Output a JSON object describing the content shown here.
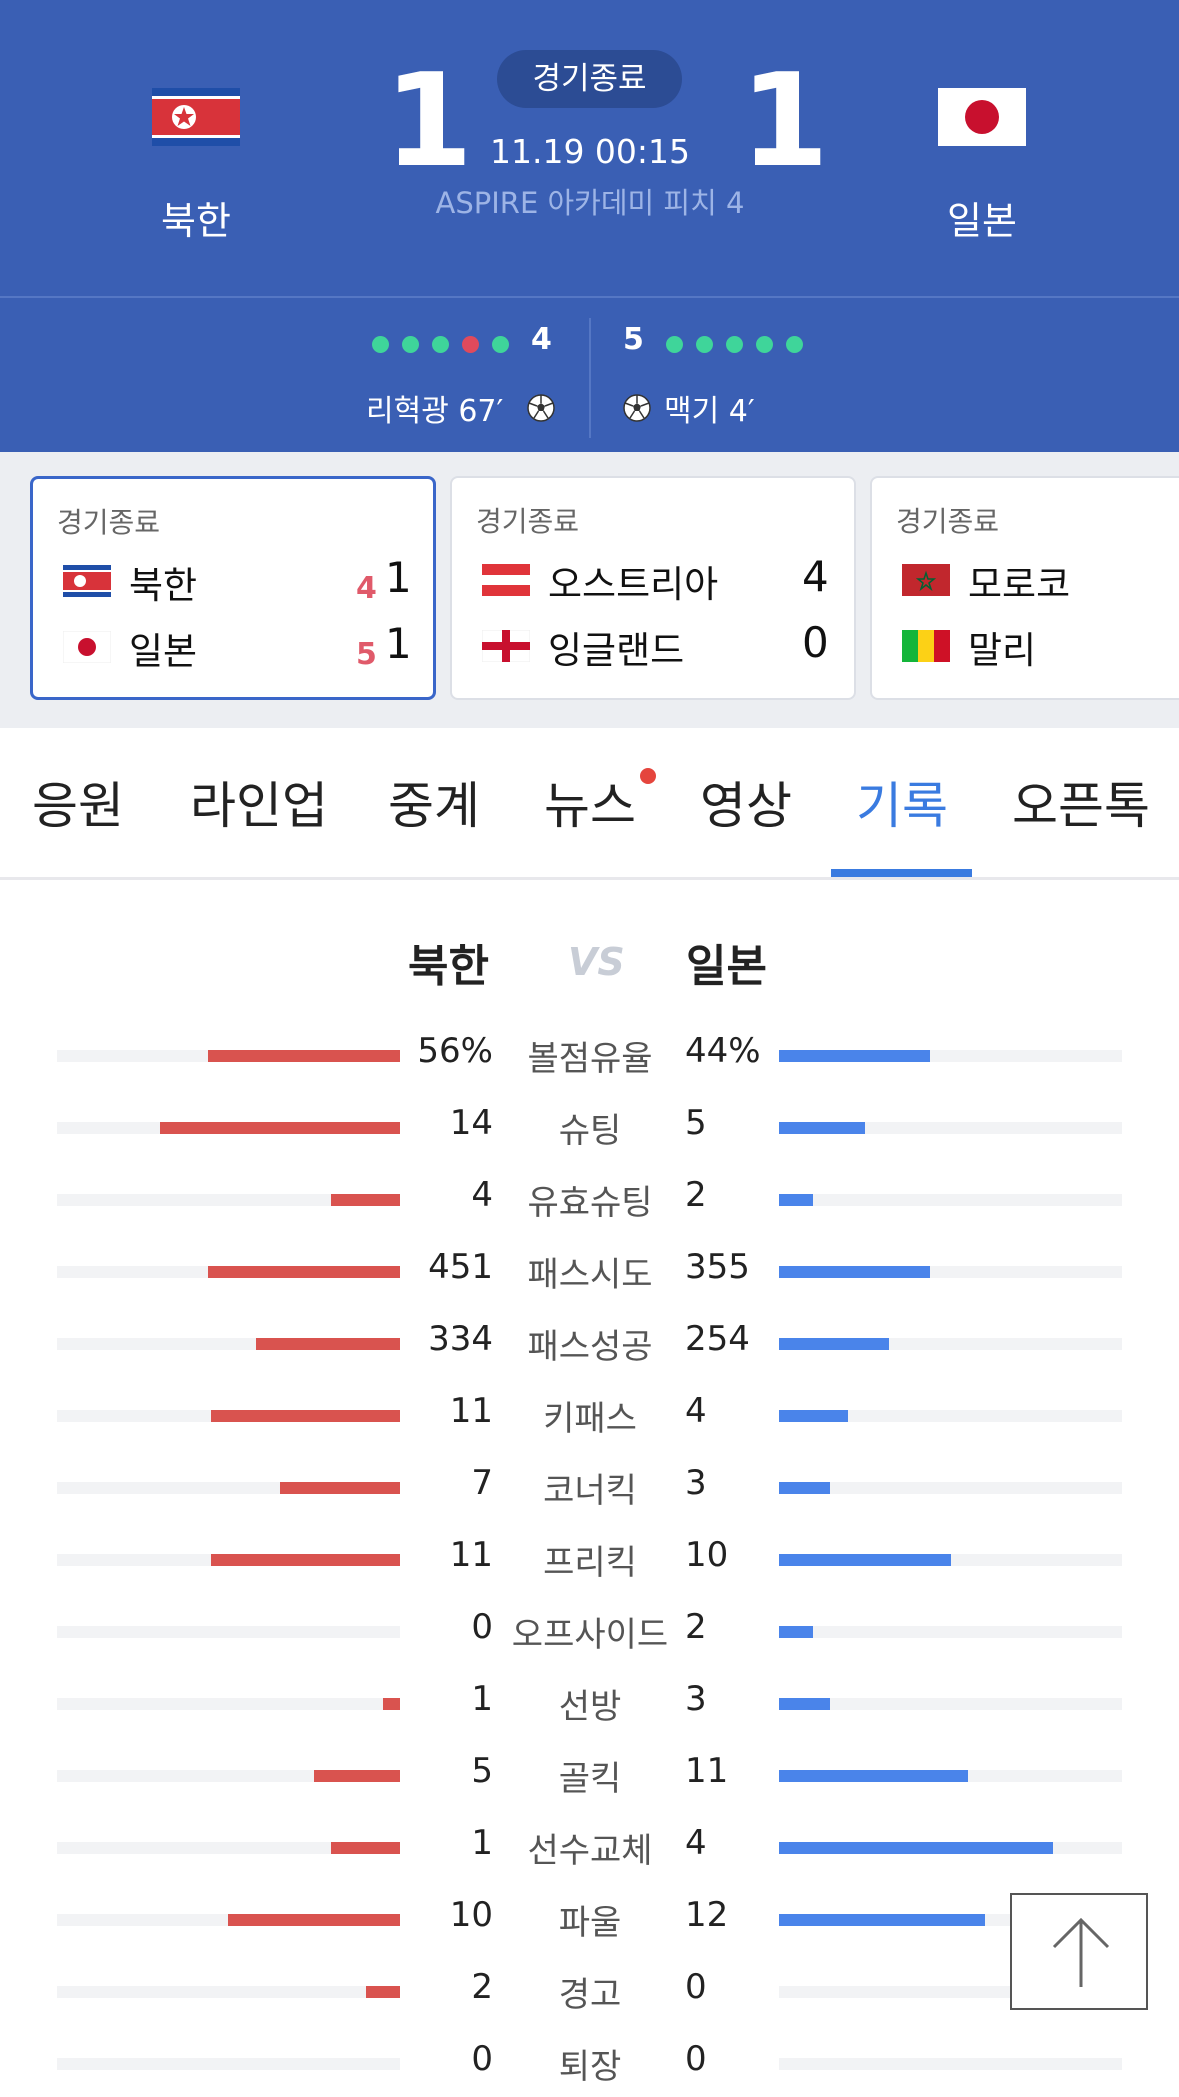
{
  "header": {
    "status": "경기종료",
    "home_team": "북한",
    "away_team": "일본",
    "home_score": "1",
    "away_score": "1",
    "datetime": "11.19 00:15",
    "venue": "ASPIRE 아카데미 피치 4"
  },
  "shootout": {
    "home_pk": "4",
    "away_pk": "5",
    "home_kicks": [
      "scored",
      "scored",
      "scored",
      "missed",
      "scored"
    ],
    "away_kicks": [
      "scored",
      "scored",
      "scored",
      "scored",
      "scored"
    ],
    "home_scorer": "리혁광 67′",
    "away_scorer": "맥기 4′",
    "colors": {
      "scored": "#3fd59a",
      "missed": "#e04a5c"
    }
  },
  "cards": [
    {
      "status": "경기종료",
      "home": "북한",
      "away": "일본",
      "home_pk": "4",
      "away_pk": "5",
      "home_score": "1",
      "away_score": "1"
    },
    {
      "status": "경기종료",
      "home": "오스트리아",
      "away": "잉글랜드",
      "home_score": "4",
      "away_score": "0"
    },
    {
      "status": "경기종료",
      "home": "모로코",
      "away": "말리"
    }
  ],
  "tabs": [
    "응원",
    "라인업",
    "중계",
    "뉴스",
    "영상",
    "기록",
    "오픈톡"
  ],
  "active_tab": "기록",
  "stats_header": {
    "home": "북한",
    "vs": "VS",
    "away": "일본"
  },
  "stats": [
    {
      "label": "볼점유율",
      "home": "56%",
      "away": "44%",
      "home_frac": 0.56,
      "away_frac": 0.44
    },
    {
      "label": "슈팅",
      "home": "14",
      "away": "5",
      "home_frac": 0.7,
      "away_frac": 0.25
    },
    {
      "label": "유효슈팅",
      "home": "4",
      "away": "2",
      "home_frac": 0.2,
      "away_frac": 0.1
    },
    {
      "label": "패스시도",
      "home": "451",
      "away": "355",
      "home_frac": 0.56,
      "away_frac": 0.44
    },
    {
      "label": "패스성공",
      "home": "334",
      "away": "254",
      "home_frac": 0.42,
      "away_frac": 0.32
    },
    {
      "label": "키패스",
      "home": "11",
      "away": "4",
      "home_frac": 0.55,
      "away_frac": 0.2
    },
    {
      "label": "코너킥",
      "home": "7",
      "away": "3",
      "home_frac": 0.35,
      "away_frac": 0.15
    },
    {
      "label": "프리킥",
      "home": "11",
      "away": "10",
      "home_frac": 0.55,
      "away_frac": 0.5
    },
    {
      "label": "오프사이드",
      "home": "0",
      "away": "2",
      "home_frac": 0,
      "away_frac": 0.1
    },
    {
      "label": "선방",
      "home": "1",
      "away": "3",
      "home_frac": 0.05,
      "away_frac": 0.15
    },
    {
      "label": "골킥",
      "home": "5",
      "away": "11",
      "home_frac": 0.25,
      "away_frac": 0.55
    },
    {
      "label": "선수교체",
      "home": "1",
      "away": "4",
      "home_frac": 0.2,
      "away_frac": 0.8
    },
    {
      "label": "파울",
      "home": "10",
      "away": "12",
      "home_frac": 0.5,
      "away_frac": 0.6
    },
    {
      "label": "경고",
      "home": "2",
      "away": "0",
      "home_frac": 0.1,
      "away_frac": 0
    },
    {
      "label": "퇴장",
      "home": "0",
      "away": "0",
      "home_frac": 0,
      "away_frac": 0
    }
  ]
}
